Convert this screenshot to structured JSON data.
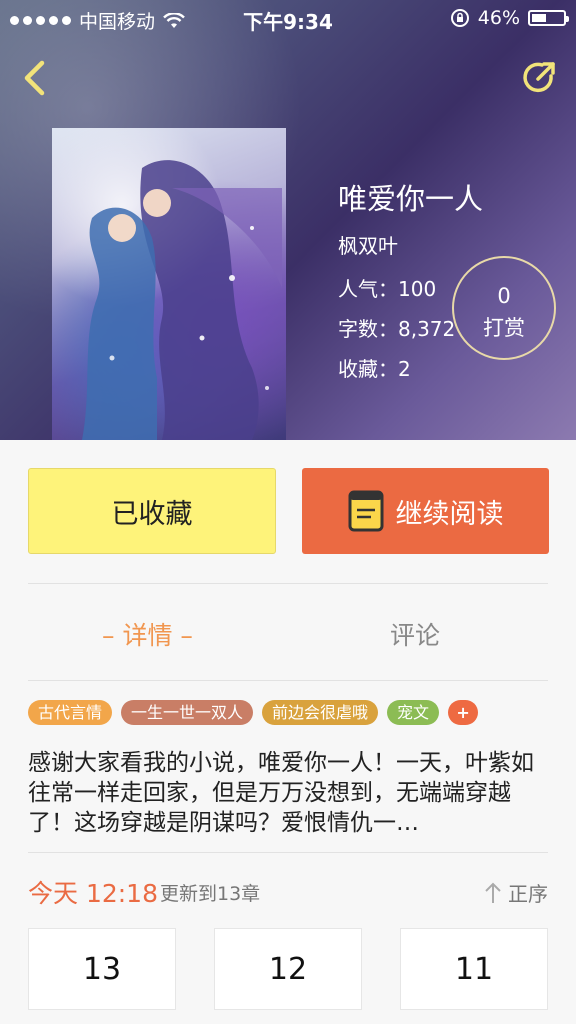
{
  "status_bar": {
    "carrier": "中国移动",
    "time": "下午9:34",
    "battery": "46%"
  },
  "book": {
    "title": "唯爱你一人",
    "author": "枫双叶",
    "popularity_label": "人气：",
    "popularity": "100",
    "word_count_label": "字数：",
    "word_count": "8,372",
    "favorites_label": "收藏：",
    "favorites": "2"
  },
  "tip": {
    "count": "0",
    "label": "打赏"
  },
  "actions": {
    "collected": "已收藏",
    "continue_reading": "继续阅读"
  },
  "tabs": {
    "detail": "– 详情 –",
    "comments": "评论"
  },
  "tags": [
    {
      "label": "古代言情",
      "color": "#f2a64a"
    },
    {
      "label": "一生一世一双人",
      "color": "#c97e66"
    },
    {
      "label": "前边会很虐哦",
      "color": "#d9a23d"
    },
    {
      "label": "宠文",
      "color": "#8cbc54"
    },
    {
      "label": "+",
      "color": "#ee6a42"
    }
  ],
  "description": "感谢大家看我的小说，唯爱你一人！一天，叶紫如往常一样走回家，但是万万没想到，无端端穿越了！这场穿越是阴谋吗？爱恨情仇一…",
  "update": {
    "time": "今天 12:18",
    "text": "更新到13章",
    "sort": "正序"
  },
  "chapters": [
    "13",
    "12",
    "11"
  ],
  "colors": {
    "accent_orange": "#eb6a42",
    "collected_yellow": "#fef37a",
    "tab_active": "#f1964f"
  }
}
